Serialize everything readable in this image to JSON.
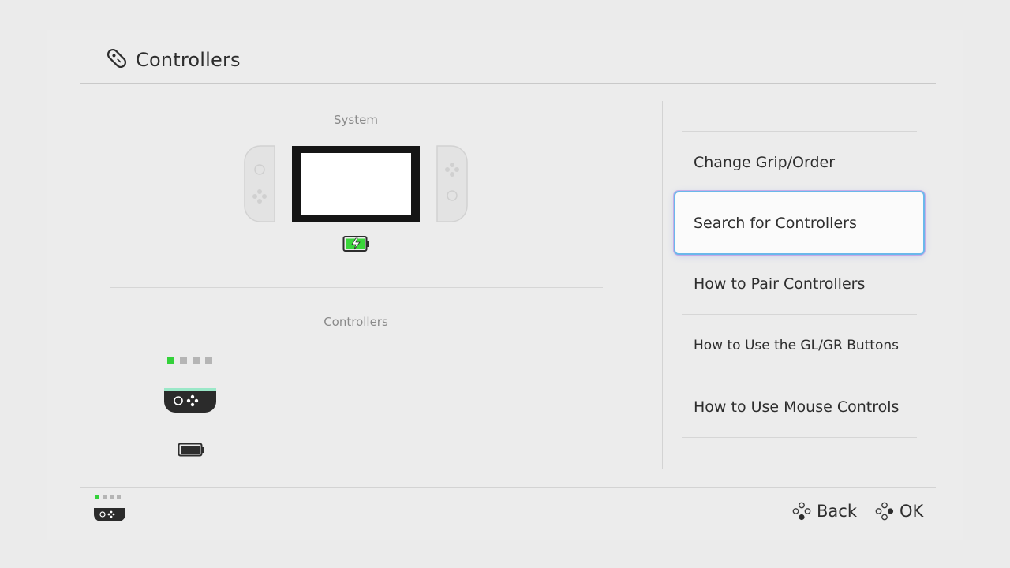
{
  "header": {
    "title": "Controllers",
    "icon": "joycon-icon"
  },
  "left_panel": {
    "system_label": "System",
    "controllers_label": "Controllers",
    "player_indicator": {
      "active": 1,
      "total": 4
    }
  },
  "menu": {
    "items": [
      {
        "label": "Change Grip/Order",
        "selected": false
      },
      {
        "label": "Search for Controllers",
        "selected": true
      },
      {
        "label": "How to Pair Controllers",
        "selected": false
      },
      {
        "label": "How to Use the GL/GR Buttons",
        "selected": false
      },
      {
        "label": "How to Use Mouse Controls",
        "selected": false
      }
    ]
  },
  "footer": {
    "back_label": "Back",
    "ok_label": "OK"
  },
  "colors": {
    "accent_green": "#33d13a",
    "selection_border": "#6ab8ea",
    "background": "#ebebeb"
  }
}
